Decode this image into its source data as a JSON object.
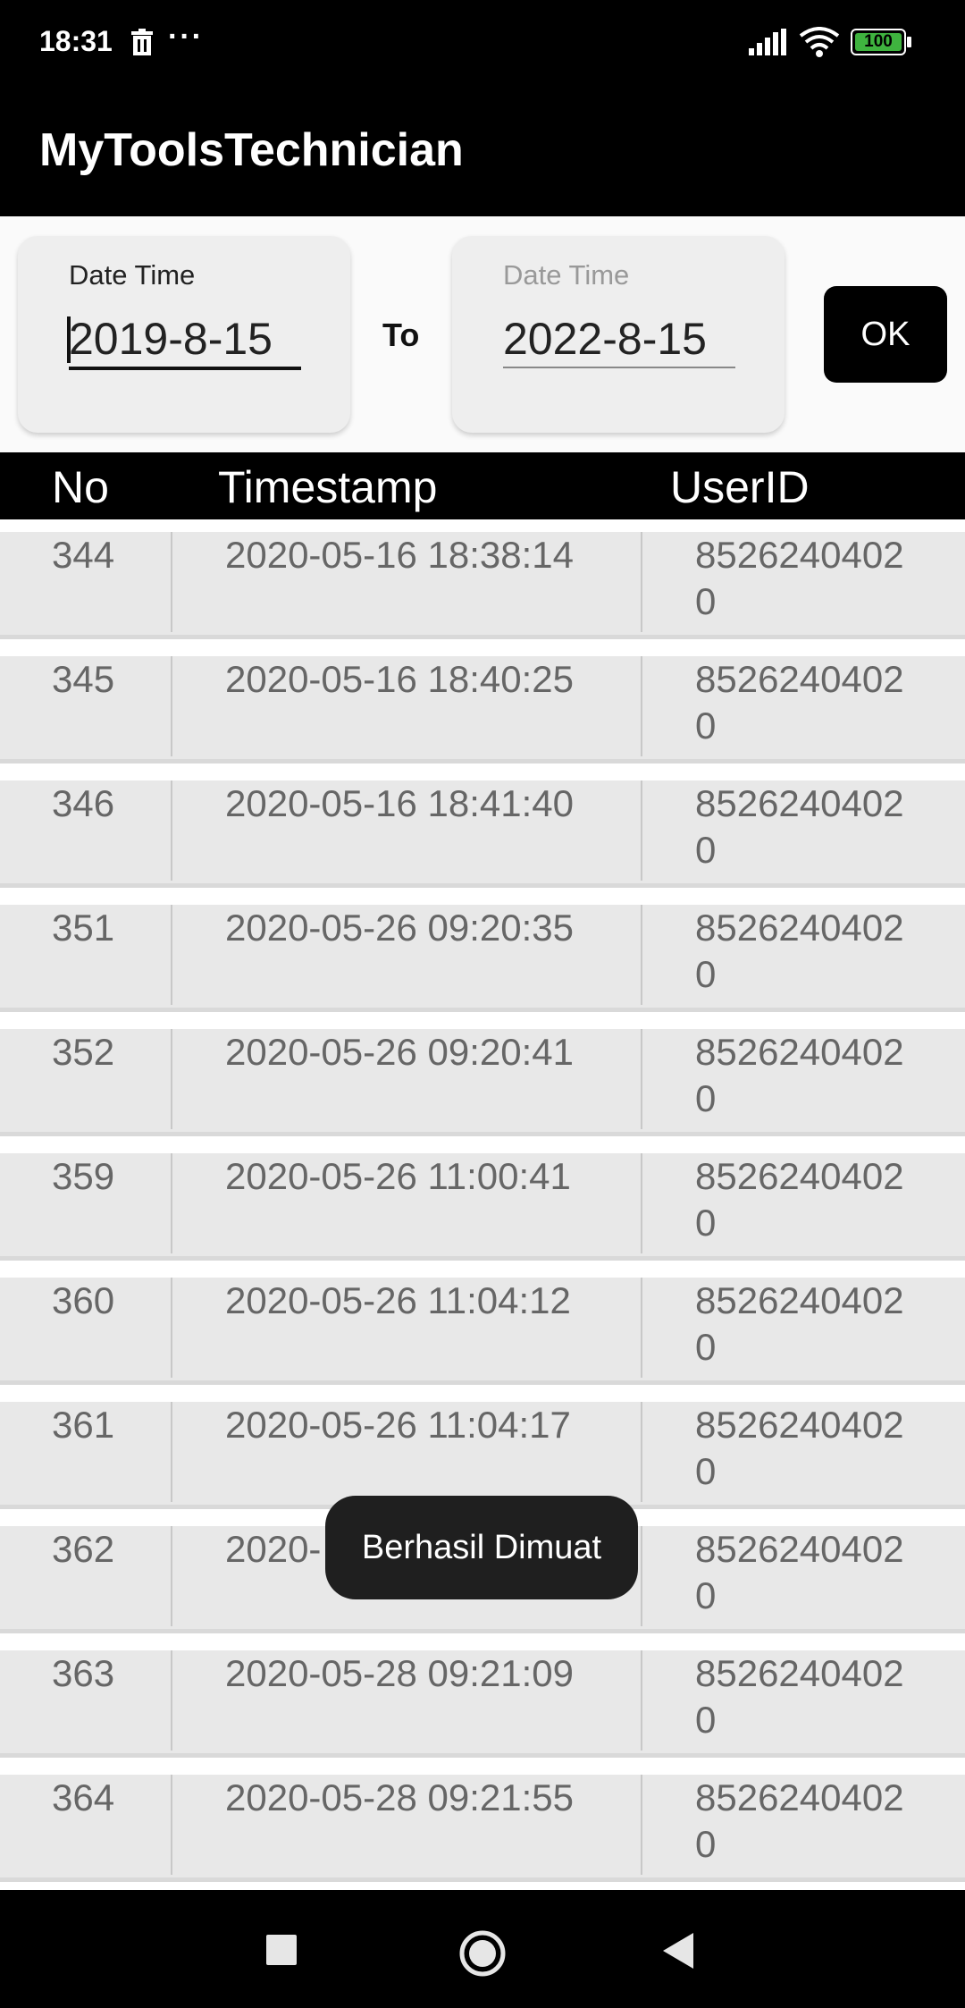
{
  "status_bar": {
    "time": "18:31",
    "dots": "···",
    "battery": "100"
  },
  "app_bar": {
    "title": "MyToolsTechnician"
  },
  "filter": {
    "from": {
      "label": "Date Time",
      "value": "2019-8-15"
    },
    "separator": "To",
    "to": {
      "label": "Date Time",
      "value": "2022-8-15"
    },
    "ok_label": "OK"
  },
  "table": {
    "headers": {
      "no": "No",
      "timestamp": "Timestamp",
      "userid": "UserID"
    },
    "rows": [
      {
        "no": "344",
        "timestamp": "2020-05-16 18:38:14",
        "userid": "85262404020"
      },
      {
        "no": "345",
        "timestamp": "2020-05-16 18:40:25",
        "userid": "85262404020"
      },
      {
        "no": "346",
        "timestamp": "2020-05-16 18:41:40",
        "userid": "85262404020"
      },
      {
        "no": "351",
        "timestamp": "2020-05-26 09:20:35",
        "userid": "85262404020"
      },
      {
        "no": "352",
        "timestamp": "2020-05-26 09:20:41",
        "userid": "85262404020"
      },
      {
        "no": "359",
        "timestamp": "2020-05-26 11:00:41",
        "userid": "85262404020"
      },
      {
        "no": "360",
        "timestamp": "2020-05-26 11:04:12",
        "userid": "85262404020"
      },
      {
        "no": "361",
        "timestamp": "2020-05-26 11:04:17",
        "userid": "85262404020"
      },
      {
        "no": "362",
        "timestamp": "2020-",
        "userid": "85262404020"
      },
      {
        "no": "363",
        "timestamp": "2020-05-28 09:21:09",
        "userid": "85262404020"
      },
      {
        "no": "364",
        "timestamp": "2020-05-28 09:21:55",
        "userid": "85262404020"
      }
    ]
  },
  "toast": {
    "message": "Berhasil Dimuat"
  },
  "colors": {
    "bar_background": "#000000",
    "row_background": "#e8e8e8",
    "cell_text": "#666666",
    "battery_green": "#3fb33f",
    "toast_background": "#1f1f1f"
  },
  "icons": {
    "status": [
      "trash-icon",
      "signal-icon",
      "wifi-icon",
      "battery-icon"
    ],
    "navigation": [
      "recents-icon",
      "home-icon",
      "back-icon"
    ]
  }
}
